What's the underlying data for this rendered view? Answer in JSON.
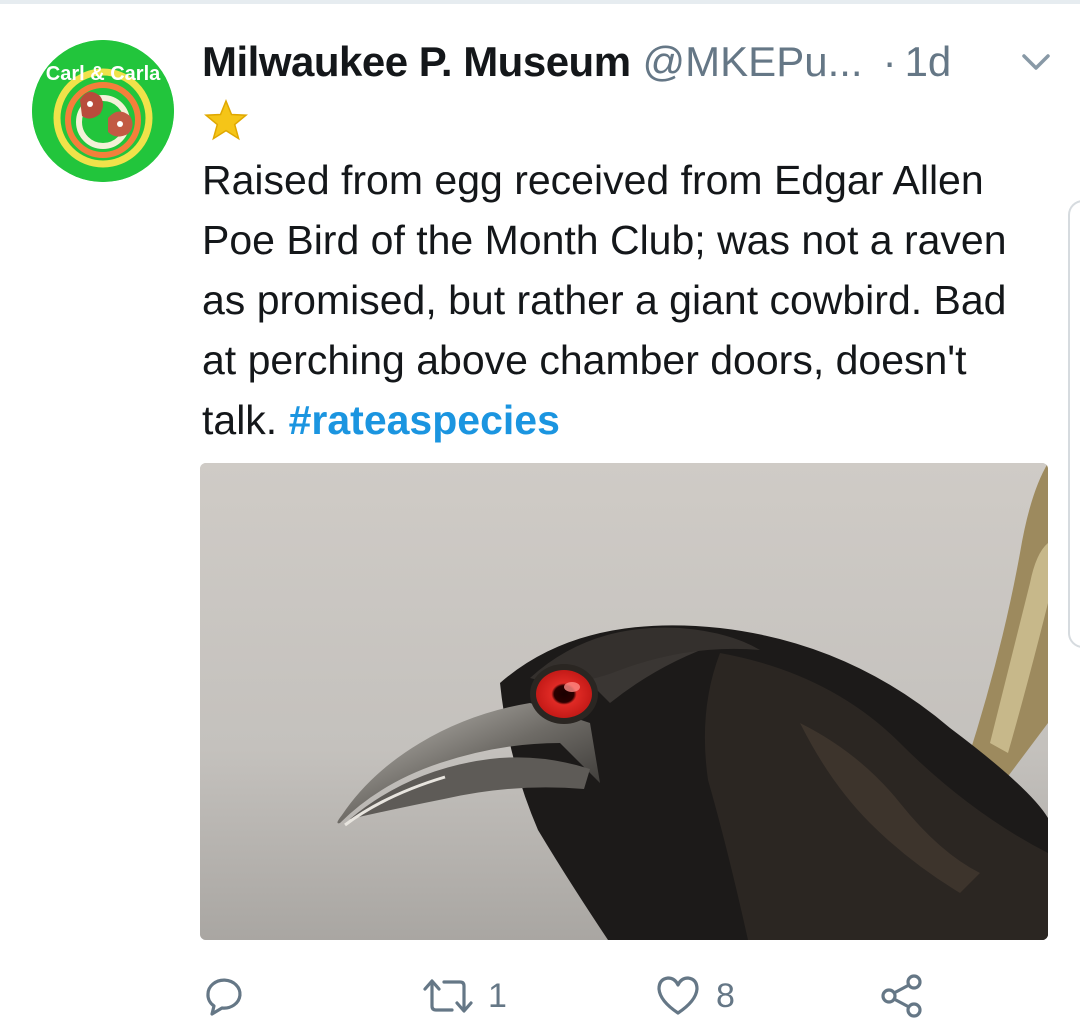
{
  "tweet": {
    "display_name": "Milwaukee P. Museum",
    "handle": "@MKEPu...",
    "separator": "·",
    "timestamp": "1d",
    "text_main": "Raised from egg received from Edgar Allen Poe Bird of the Month Club; was not a raven as promised, but rather a giant cowbird. Bad at perching above chamber doors, doesn't talk.",
    "hashtag": "#rateaspecies",
    "avatar_text": "Carl & Carla"
  },
  "actions": {
    "reply_count": "",
    "retweet_count": "1",
    "like_count": "8",
    "share_count": ""
  },
  "colors": {
    "hashtag": "#1b95e0",
    "meta_text": "#657786",
    "avatar_bg": "#22c53c",
    "star": "#f5c518"
  },
  "icons": {
    "header": [
      "chevron-down-icon",
      "star-icon"
    ],
    "actions": [
      "reply-icon",
      "retweet-icon",
      "heart-icon",
      "share-icon"
    ]
  }
}
